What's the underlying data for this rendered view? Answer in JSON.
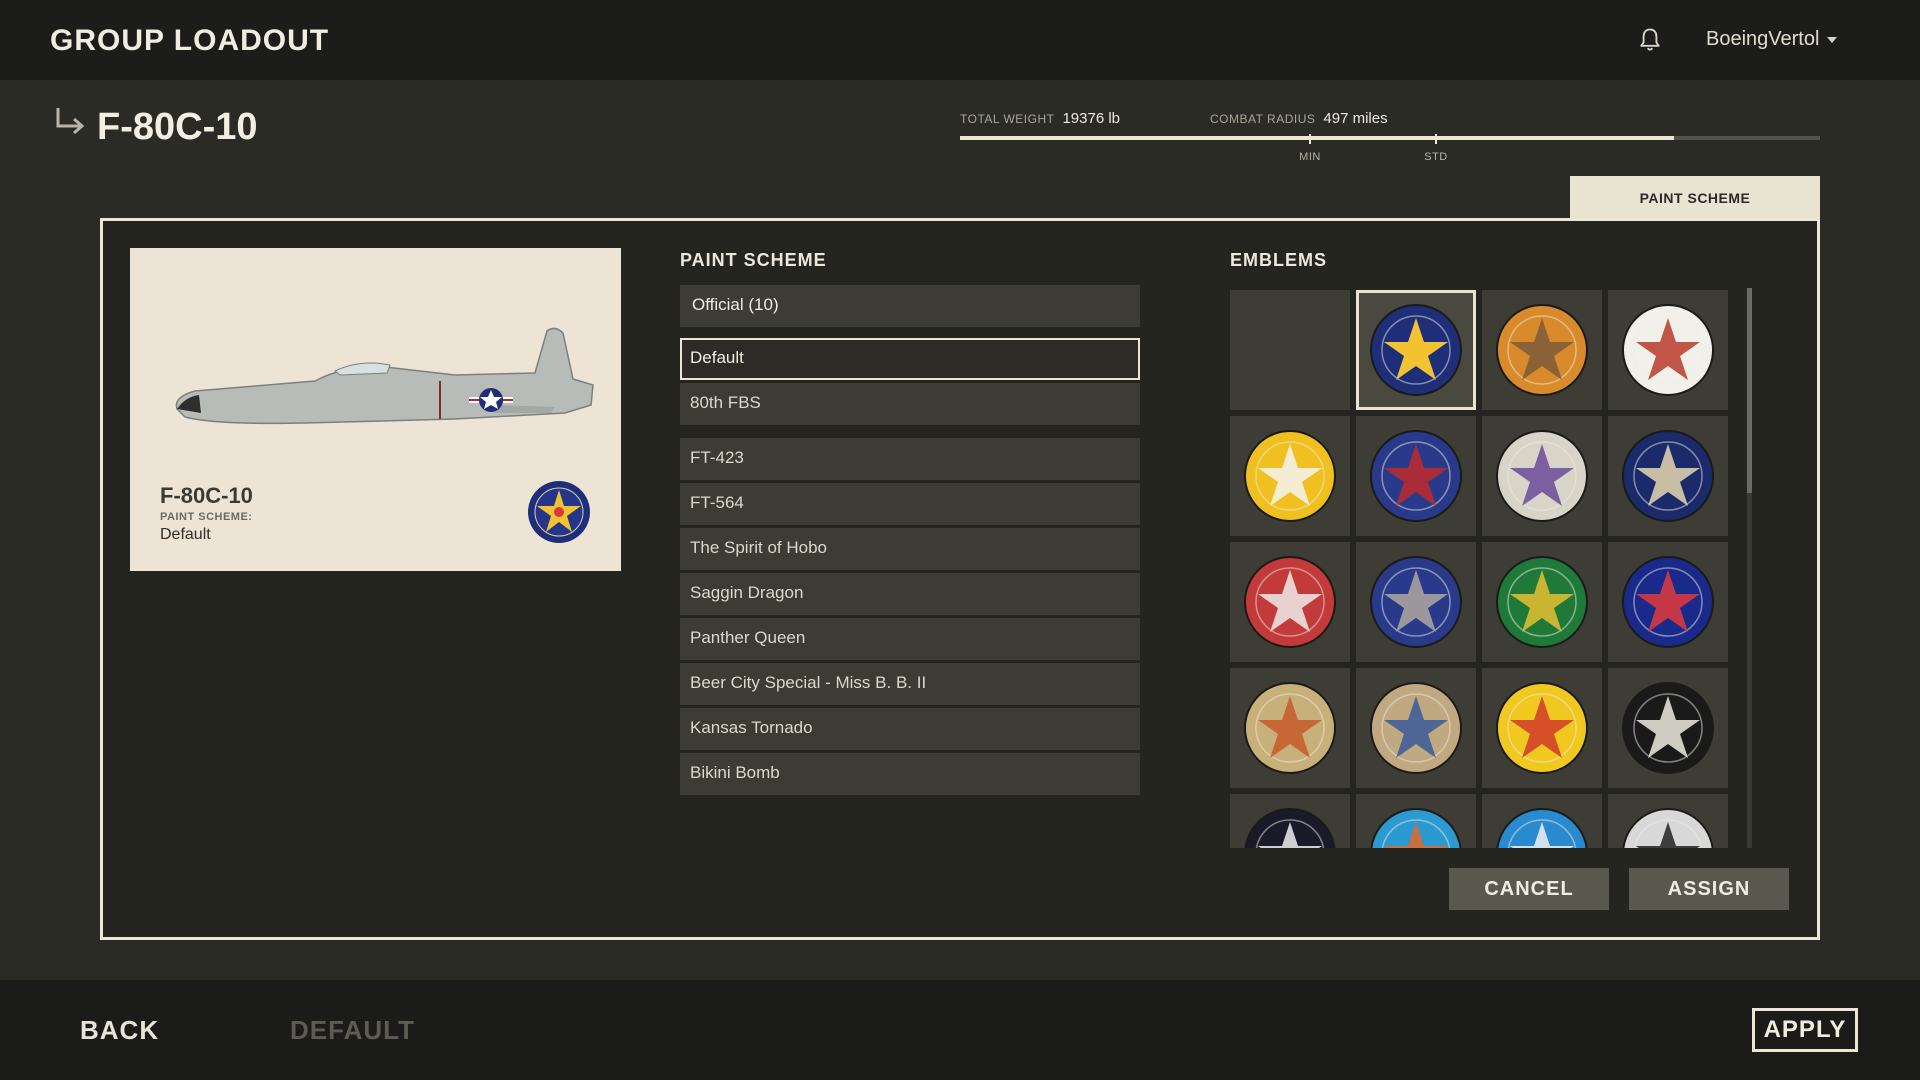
{
  "header": {
    "title": "GROUP LOADOUT",
    "username": "BoeingVertol"
  },
  "aircraft": {
    "name": "F-80C-10"
  },
  "stats": {
    "total_weight_label": "TOTAL WEIGHT",
    "total_weight_value": "19376 lb",
    "combat_radius_label": "COMBAT RADIUS",
    "combat_radius_value": "497 miles",
    "radius_fill_fraction": 0.83,
    "min_label": "MIN",
    "std_label": "STD"
  },
  "tab": {
    "label": "PAINT SCHEME"
  },
  "preview": {
    "name": "F-80C-10",
    "scheme_label": "PAINT SCHEME:",
    "scheme_value": "Default"
  },
  "paint_scheme": {
    "title": "PAINT SCHEME",
    "dropdown": "Official (10)",
    "items": [
      {
        "label": "Default",
        "selected": true
      },
      {
        "label": "80th FBS"
      },
      {
        "label": "FT-423"
      },
      {
        "label": "FT-564"
      },
      {
        "label": "The Spirit of Hobo"
      },
      {
        "label": "Saggin Dragon"
      },
      {
        "label": "Panther Queen"
      },
      {
        "label": "Beer City Special - Miss B. B. II"
      },
      {
        "label": "Kansas Tornado"
      },
      {
        "label": "Bikini Bomb"
      }
    ]
  },
  "emblems": {
    "title": "EMBLEMS",
    "items": [
      {
        "icon": "empty-slot",
        "outer": "none",
        "inner": "none"
      },
      {
        "icon": "star-roundel-emblem",
        "outer": "#1f2e78",
        "inner": "#f2c230",
        "selected": true
      },
      {
        "icon": "cat-emblem",
        "outer": "#d98a2a",
        "inner": "#7a5a3a"
      },
      {
        "icon": "indian-chief-stars-emblem",
        "outer": "#f2f0ea",
        "inner": "#b83a2a"
      },
      {
        "icon": "eagle-yellow-emblem",
        "outer": "#f0c020",
        "inner": "#f4f4f4"
      },
      {
        "icon": "shield-axe-emblem",
        "outer": "#2a3a8a",
        "inner": "#c22a2a"
      },
      {
        "icon": "dog-bomb-emblem",
        "outer": "#d8d4c8",
        "inner": "#6a4a9a"
      },
      {
        "icon": "eagle-star-emblem",
        "outer": "#1a2a6a",
        "inner": "#e8d8b0"
      },
      {
        "icon": "bulldog-emblem",
        "outer": "#c23a3a",
        "inner": "#f0ecea"
      },
      {
        "icon": "donkey-emblem",
        "outer": "#2a3a8a",
        "inner": "#b0a8a0"
      },
      {
        "icon": "dragon-emblem",
        "outer": "#1f7a3a",
        "inner": "#e8c030"
      },
      {
        "icon": "blue-bird-emblem",
        "outer": "#1a2a8a",
        "inner": "#e23a3a"
      },
      {
        "icon": "warrior-emblem",
        "outer": "#c8b07a",
        "inner": "#c85a2a"
      },
      {
        "icon": "sailor-emblem",
        "outer": "#c0a880",
        "inner": "#3a5a9a"
      },
      {
        "icon": "red-bird-emblem",
        "outer": "#f0c820",
        "inner": "#d23a2a"
      },
      {
        "icon": "chief-headdress-emblem",
        "outer": "#1a1a1a",
        "inner": "#f0ece0"
      },
      {
        "icon": "stars-flag-emblem",
        "outer": "#1a1a2a",
        "inner": "#f0f0f0"
      },
      {
        "icon": "rooster-emblem",
        "outer": "#2a9ad0",
        "inner": "#e06a2a"
      },
      {
        "icon": "bunny-emblem",
        "outer": "#2a8ad0",
        "inner": "#f0f0f0"
      },
      {
        "icon": "black-bird-emblem",
        "outer": "#d8d8d8",
        "inner": "#222222"
      }
    ]
  },
  "actions": {
    "cancel": "CANCEL",
    "assign": "ASSIGN"
  },
  "footer": {
    "back": "BACK",
    "default": "DEFAULT",
    "apply": "APPLY"
  },
  "colors": {
    "accent": "#ece6d6",
    "disabled_text": "#5e5c52"
  }
}
